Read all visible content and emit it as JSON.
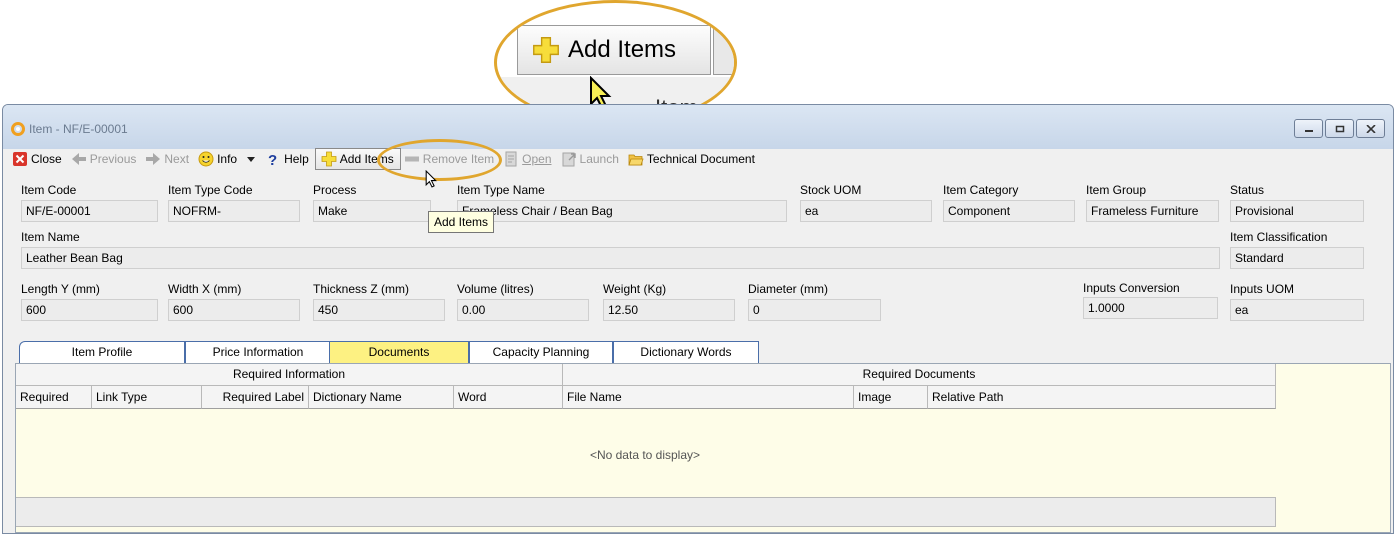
{
  "window": {
    "title": "Item - NF/E-00001"
  },
  "toolbar": {
    "close": "Close",
    "previous": "Previous",
    "next": "Next",
    "info": "Info",
    "help": "Help",
    "add_items": "Add Items",
    "remove_item": "Remove Item",
    "open": "Open",
    "launch": "Launch",
    "technical_document": "Technical Document"
  },
  "tooltip": "Add Items",
  "callout": {
    "button_label": "Add Items",
    "partial_text": "Item"
  },
  "fields": {
    "item_code": {
      "label": "Item Code",
      "value": "NF/E-00001"
    },
    "item_type_code": {
      "label": "Item Type Code",
      "value": "NOFRM-"
    },
    "process": {
      "label": "Process",
      "value": "Make"
    },
    "item_type_name": {
      "label": "Item Type Name",
      "value": "Frameless Chair / Bean Bag"
    },
    "stock_uom": {
      "label": "Stock UOM",
      "value": "ea"
    },
    "item_category": {
      "label": "Item Category",
      "value": "Component"
    },
    "item_group": {
      "label": "Item Group",
      "value": "Frameless Furniture"
    },
    "status": {
      "label": "Status",
      "value": "Provisional"
    },
    "item_name": {
      "label": "Item Name",
      "value": "Leather Bean Bag"
    },
    "item_classification": {
      "label": "Item Classification",
      "value": "Standard"
    },
    "length_y": {
      "label": "Length Y (mm)",
      "value": "600"
    },
    "width_x": {
      "label": "Width X (mm)",
      "value": "600"
    },
    "thickness_z": {
      "label": "Thickness Z (mm)",
      "value": "450"
    },
    "volume": {
      "label": "Volume (litres)",
      "value": "0.00"
    },
    "weight": {
      "label": "Weight (Kg)",
      "value": "12.50"
    },
    "diameter": {
      "label": "Diameter (mm)",
      "value": "0"
    },
    "inputs_conversion": {
      "label": "Inputs Conversion",
      "value": "1.0000"
    },
    "inputs_uom": {
      "label": "Inputs UOM",
      "value": "ea"
    }
  },
  "tabs": [
    "Item Profile",
    "Price Information",
    "Documents",
    "Capacity Planning",
    "Dictionary Words"
  ],
  "active_tab": "Documents",
  "grid": {
    "bands": [
      "Required Information",
      "Required Documents"
    ],
    "columns": [
      "Required",
      "Link Type",
      "Required Label",
      "Dictionary Name",
      "Word",
      "File Name",
      "Image",
      "Relative Path"
    ],
    "empty_text": "<No data to display>"
  },
  "colors": {
    "callout_ring": "#e0a62e",
    "active_tab": "#fdf182",
    "grid_background": "#fefde8"
  }
}
